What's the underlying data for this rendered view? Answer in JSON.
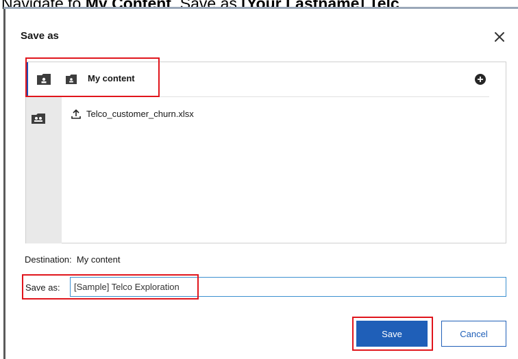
{
  "instruction": {
    "prefix": "Navigate to ",
    "bold_location": "My Content",
    "middle": ". Save as ",
    "bold_name": "[Your Lastname] Telc"
  },
  "dialog": {
    "title": "Save as",
    "close_icon": "close-icon"
  },
  "browser": {
    "header_label": "My content",
    "header_icon": "folder-user-icon",
    "add_icon": "add-circle-icon",
    "items": [
      {
        "name": "Telco_customer_churn.xlsx",
        "icon": "upload-icon"
      }
    ]
  },
  "destination": {
    "label": "Destination:",
    "value": "My content"
  },
  "save_as": {
    "label": "Save as:",
    "value": "[Sample] Telco Exploration"
  },
  "buttons": {
    "save": "Save",
    "cancel": "Cancel"
  },
  "colors": {
    "primary": "#1f5fb8",
    "selection_bar": "#1e4fb5",
    "highlight": "#e0141b",
    "input_border": "#3b8fd0"
  }
}
